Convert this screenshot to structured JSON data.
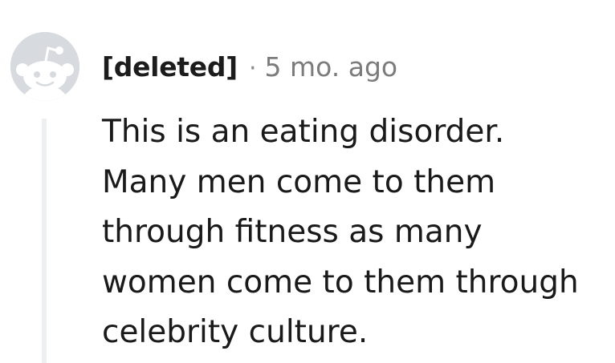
{
  "comment": {
    "author": "[deleted]",
    "separator": "·",
    "time_ago": "5 mo. ago",
    "body": "This is an eating disorder.\nMany men come to them\nthrough fitness as many\nwomen come to them through\ncelebrity culture.",
    "avatar_icon": "snoo-icon",
    "colors": {
      "avatar_bg": "#d7dbdf",
      "thread_line": "#edeff1",
      "text": "#1a1a1b",
      "muted": "#7c7c7c"
    }
  }
}
